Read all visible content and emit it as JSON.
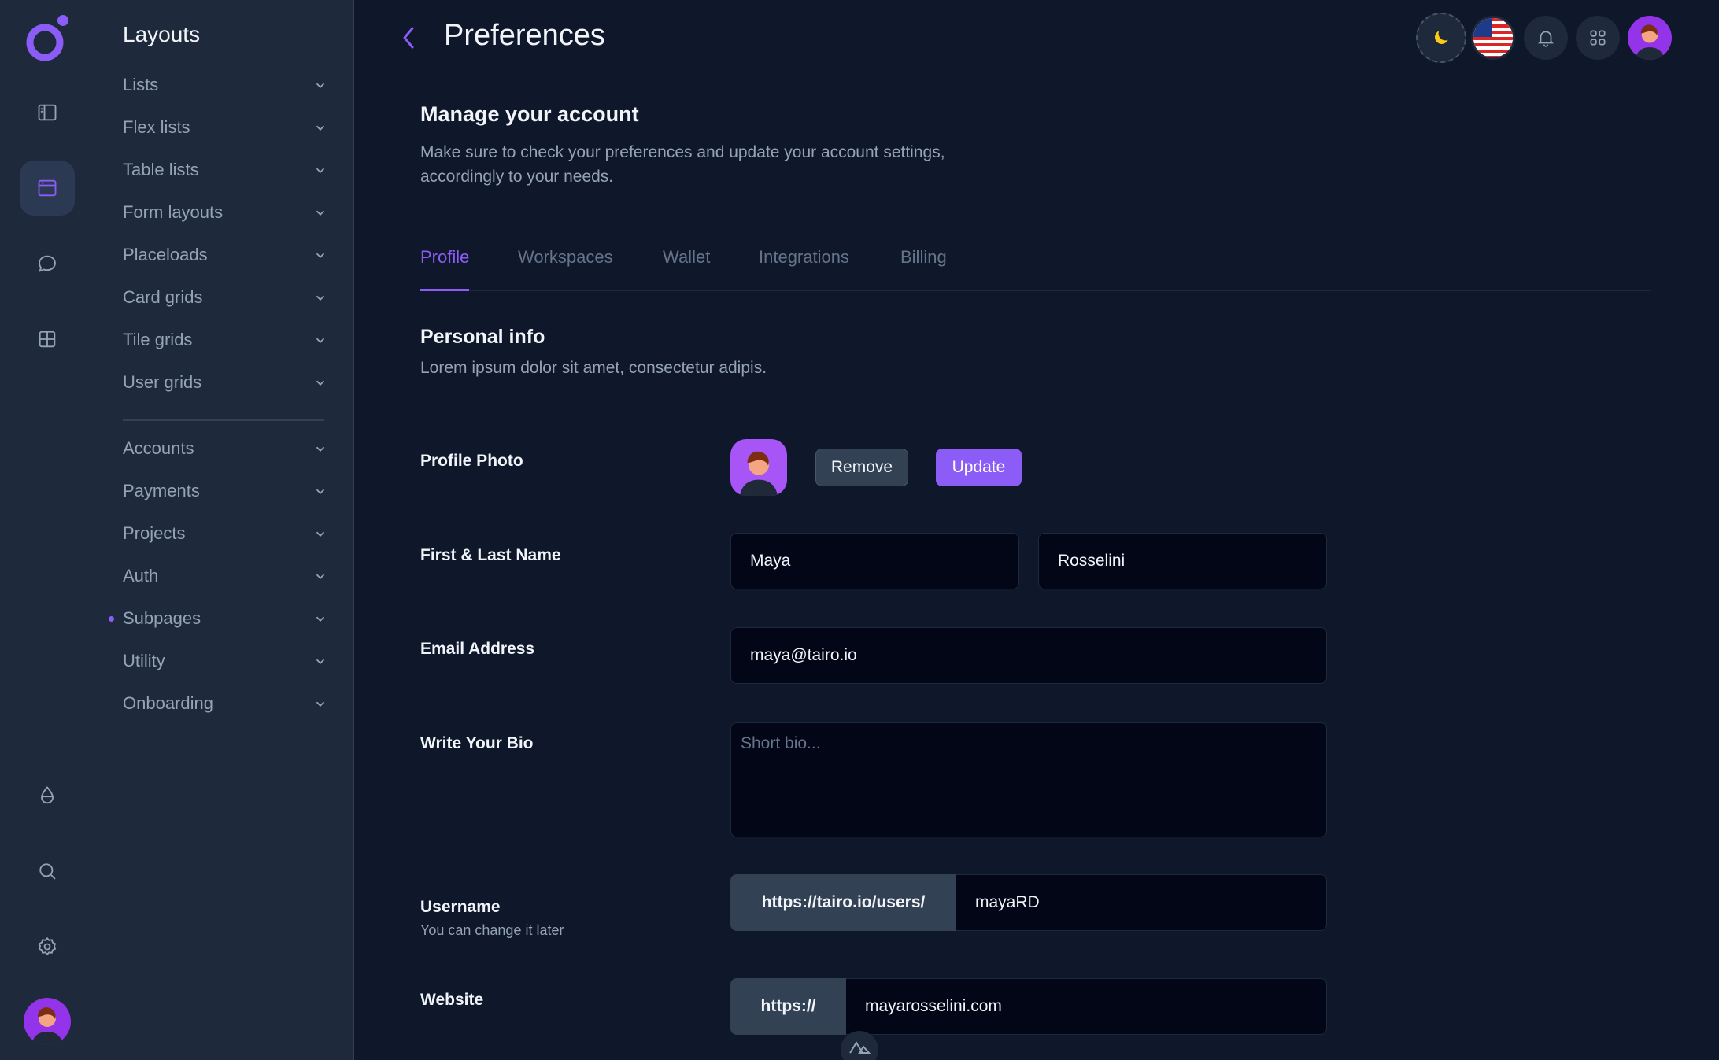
{
  "colors": {
    "accent": "#8b5cf6",
    "background": "#0f172a",
    "panel": "#1e293b",
    "input": "#020617"
  },
  "rail": {
    "icons": [
      "logo-icon",
      "sidebar-layout-icon",
      "browser-window-icon",
      "chat-bubble-icon",
      "grid-icon",
      "droplet-icon",
      "search-icon",
      "gear-icon",
      "user-avatar"
    ]
  },
  "subnav": {
    "title": "Layouts",
    "group1": [
      "Lists",
      "Flex lists",
      "Table lists",
      "Form layouts",
      "Placeloads",
      "Card grids",
      "Tile grids",
      "User grids"
    ],
    "group2": [
      "Accounts",
      "Payments",
      "Projects",
      "Auth",
      "Subpages",
      "Utility",
      "Onboarding"
    ],
    "active": "Subpages"
  },
  "header": {
    "title": "Preferences"
  },
  "main": {
    "heading": "Manage your account",
    "description": "Make sure to check your preferences and update your account settings, accordingly to your needs.",
    "tabs": [
      "Profile",
      "Workspaces",
      "Wallet",
      "Integrations",
      "Billing"
    ],
    "active_tab": "Profile",
    "section": {
      "title": "Personal info",
      "description": "Lorem ipsum dolor sit amet, consectetur adipis."
    },
    "form": {
      "photo_label": "Profile Photo",
      "remove_label": "Remove",
      "update_label": "Update",
      "name_label": "First & Last Name",
      "first_name": "Maya",
      "last_name": "Rosselini",
      "email_label": "Email Address",
      "email": "maya@tairo.io",
      "bio_label": "Write Your Bio",
      "bio_placeholder": "Short bio...",
      "username_label": "Username",
      "username_hint": "You can change it later",
      "username_prefix": "https://tairo.io/users/",
      "username": "mayaRD",
      "website_label": "Website",
      "website_prefix": "https://",
      "website": "mayarosselini.com"
    }
  }
}
